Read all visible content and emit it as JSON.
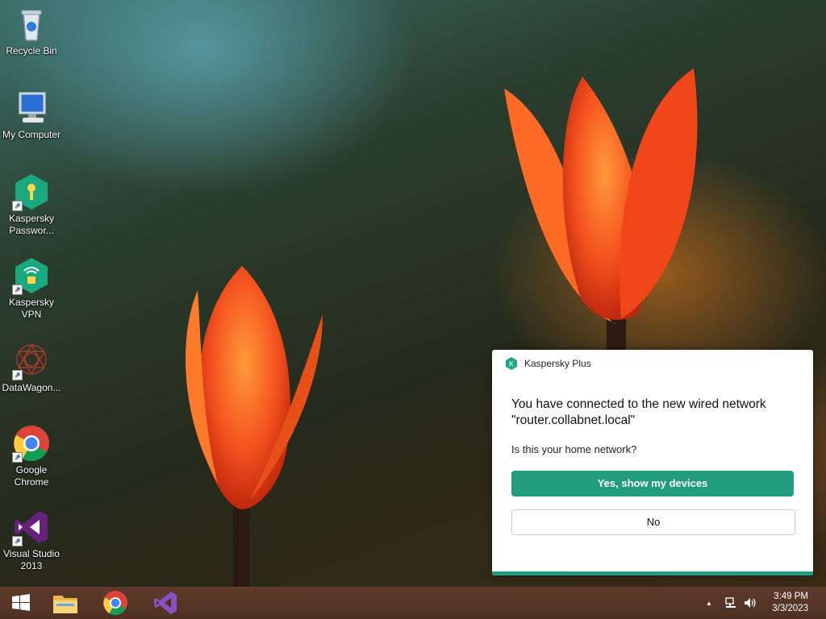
{
  "desktop": {
    "icons": [
      {
        "label": "Recycle Bin",
        "icon": "recycle-bin-icon"
      },
      {
        "label": "My Computer",
        "icon": "computer-icon"
      },
      {
        "label": "Kaspersky Passwor...",
        "icon": "kaspersky-password-icon"
      },
      {
        "label": "Kaspersky VPN",
        "icon": "kaspersky-vpn-icon"
      },
      {
        "label": "DataWagon...",
        "icon": "datawagon-icon"
      },
      {
        "label": "Google Chrome",
        "icon": "chrome-icon"
      },
      {
        "label": "Visual Studio 2013",
        "icon": "visual-studio-icon"
      }
    ]
  },
  "notification": {
    "app_name": "Kaspersky Plus",
    "title": "You have connected to the new wired network \"router.collabnet.local\"",
    "question": "Is this your home network?",
    "primary_button": "Yes, show my devices",
    "secondary_button": "No",
    "accent_color": "#229c7f"
  },
  "taskbar": {
    "pinned": [
      "windows-start-icon",
      "file-explorer-icon",
      "chrome-icon",
      "visual-studio-icon"
    ],
    "tray": {
      "overflow": "▲",
      "network": "network-icon",
      "volume": "volume-icon"
    },
    "clock": {
      "time": "3:49 PM",
      "date": "3/3/2023"
    }
  }
}
